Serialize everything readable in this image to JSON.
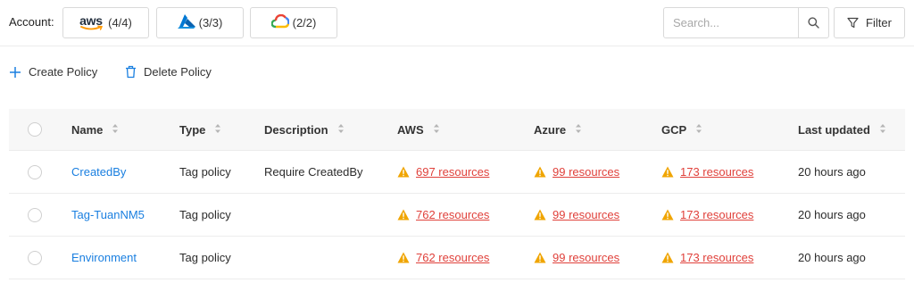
{
  "account_bar": {
    "label": "Account:",
    "accounts": [
      {
        "provider": "aws",
        "logo_text": "aws",
        "count": "(4/4)"
      },
      {
        "provider": "azure",
        "count": "(3/3)"
      },
      {
        "provider": "gcp",
        "count": "(2/2)"
      }
    ]
  },
  "search": {
    "placeholder": "Search...",
    "value": ""
  },
  "filter": {
    "label": "Filter"
  },
  "actions": {
    "create": "Create Policy",
    "delete": "Delete Policy"
  },
  "table": {
    "columns": [
      "Name",
      "Type",
      "Description",
      "AWS",
      "Azure",
      "GCP",
      "Last updated"
    ],
    "rows": [
      {
        "name": "CreatedBy",
        "type": "Tag policy",
        "description": "Require CreatedBy",
        "aws": "697 resources",
        "azure": "99 resources",
        "gcp": "173 resources",
        "updated": "20 hours ago"
      },
      {
        "name": "Tag-TuanNM5",
        "type": "Tag policy",
        "description": "",
        "aws": "762 resources",
        "azure": "99 resources",
        "gcp": "173 resources",
        "updated": "20 hours ago"
      },
      {
        "name": "Environment",
        "type": "Tag policy",
        "description": "",
        "aws": "762 resources",
        "azure": "99 resources",
        "gcp": "173 resources",
        "updated": "20 hours ago"
      }
    ]
  },
  "colors": {
    "link_blue": "#1a7fe0",
    "link_red": "#e0413b",
    "warning": "#f0a500",
    "aws_orange": "#ff9900",
    "azure_blue": "#0078d4"
  }
}
